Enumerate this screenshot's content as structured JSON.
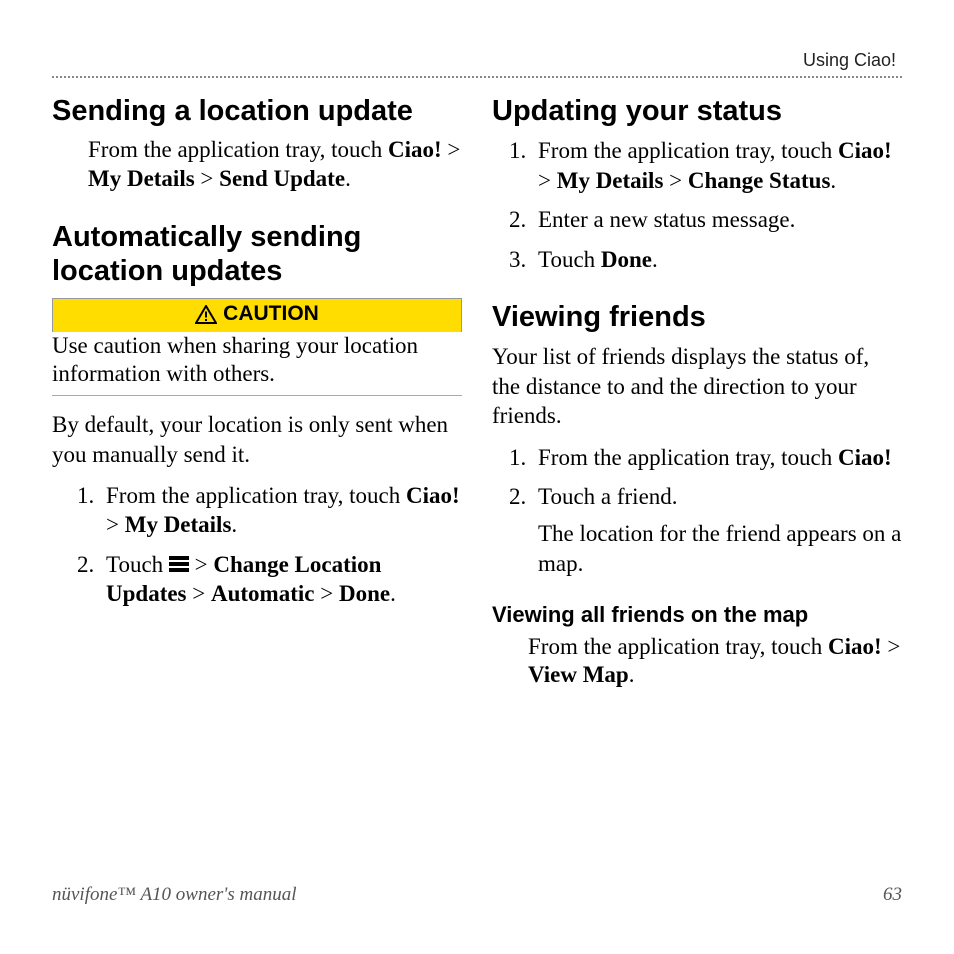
{
  "header": {
    "section": "Using Ciao!"
  },
  "left": {
    "h_send": "Sending a location update",
    "send_intro": "From the application tray, touch ",
    "send_b1": "Ciao!",
    "gt": " > ",
    "send_b2": "My Details",
    "send_b3": "Send Update",
    "period": ".",
    "h_auto": "Automatically sending location updates",
    "caution_label": "CAUTION",
    "caution_body": "Use caution when sharing your location information with others.",
    "auto_body": "By default, your location is only sent when you manually send it.",
    "auto_s1_a": "From the application tray, touch ",
    "auto_s1_b1": "Ciao!",
    "auto_s1_b2": "My Details",
    "auto_s2_a": "Touch ",
    "auto_s2_b1": "Change Location Updates",
    "auto_s2_b2": "Automatic",
    "auto_s2_b3": "Done"
  },
  "right": {
    "h_status": "Updating your status",
    "st1_a": "From the application tray, touch ",
    "st1_b1": "Ciao!",
    "st1_b2": "My Details",
    "st1_b3": "Change Status",
    "st2": "Enter a new status message.",
    "st3_a": "Touch ",
    "st3_b": "Done",
    "h_friends": "Viewing friends",
    "friends_intro": "Your list of friends displays the status of, the distance to and the direction to your friends.",
    "vf1_a": "From the application tray, touch ",
    "vf1_b": "Ciao!",
    "vf2": "Touch a friend.",
    "vf2_sub": "The location for the friend appears on a map.",
    "h_allmap": "Viewing all friends on the map",
    "allmap_a": "From the application tray, touch ",
    "allmap_b1": "Ciao!",
    "allmap_b2": "View Map"
  },
  "footer": {
    "manual": "nüvifone™ A10 owner's manual",
    "page": "63"
  }
}
